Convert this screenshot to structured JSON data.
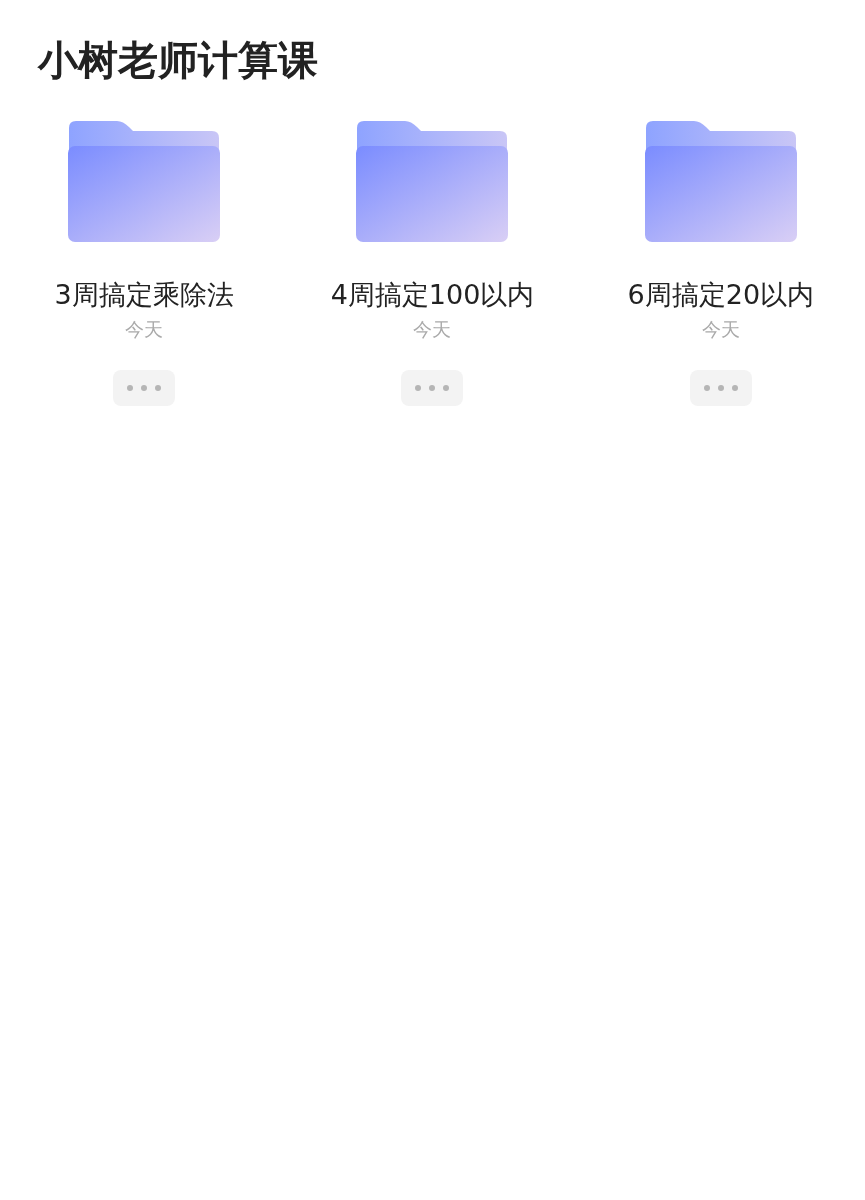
{
  "title": "小树老师计算课",
  "folders": [
    {
      "name": "3周搞定乘除法",
      "date": "今天"
    },
    {
      "name": "4周搞定100以内",
      "date": "今天"
    },
    {
      "name": "6周搞定20以内",
      "date": "今天"
    }
  ]
}
